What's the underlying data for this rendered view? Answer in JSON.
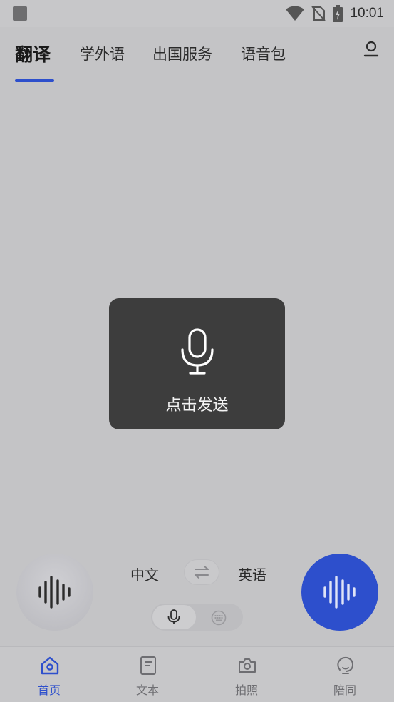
{
  "status_bar": {
    "time": "10:01"
  },
  "top_tabs": [
    {
      "label": "翻译",
      "active": true
    },
    {
      "label": "学外语",
      "active": false
    },
    {
      "label": "出国服务",
      "active": false
    },
    {
      "label": "语音包",
      "active": false
    }
  ],
  "toast": {
    "label": "点击发送",
    "icon": "microphone-icon"
  },
  "language_bar": {
    "source": "中文",
    "target": "英语",
    "swap_icon": "swap-arrows-icon"
  },
  "input_mode": {
    "selected": "voice"
  },
  "bottom_nav": [
    {
      "label": "首页",
      "icon": "home-icon",
      "active": true
    },
    {
      "label": "文本",
      "icon": "document-icon",
      "active": false
    },
    {
      "label": "拍照",
      "icon": "camera-icon",
      "active": false
    },
    {
      "label": "陪同",
      "icon": "companion-icon",
      "active": false
    }
  ],
  "colors": {
    "accent": "#2d4fcc",
    "background": "#c4c4c6",
    "toast": "#3d3d3d"
  }
}
